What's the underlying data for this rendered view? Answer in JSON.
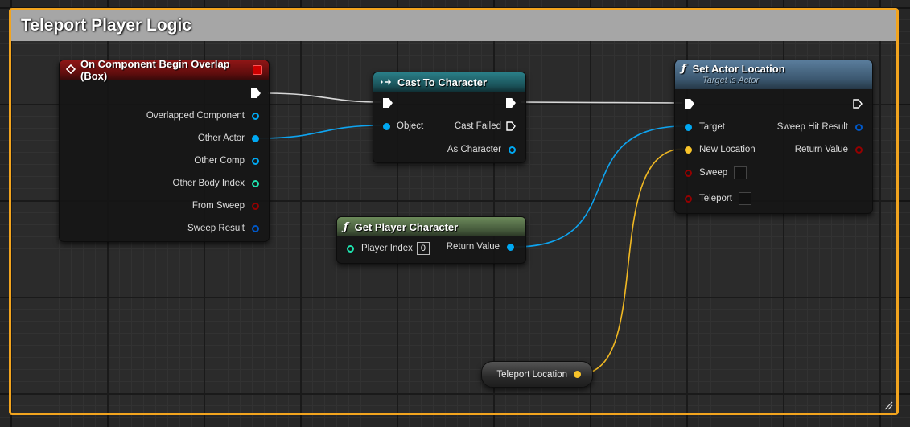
{
  "comment": {
    "title": "Teleport Player Logic",
    "color": "#f2a41e"
  },
  "colors": {
    "exec": "#ffffff",
    "object": "#00a8f2",
    "struct": "#0058c8",
    "integer": "#1fe3af",
    "boolean": "#950000",
    "vector": "#f8c42a"
  },
  "nodes": {
    "overlap": {
      "title": "On Component Begin Overlap (Box)",
      "icon": "event-diamond-icon",
      "pins": [
        "Overlapped Component",
        "Other Actor",
        "Other Comp",
        "Other Body Index",
        "From Sweep",
        "Sweep Result"
      ]
    },
    "cast": {
      "title": "Cast To Character",
      "icon": "cast-arrows-icon",
      "input": "Object",
      "outputs": [
        "Cast Failed",
        "As Character"
      ]
    },
    "get_player": {
      "title": "Get Player Character",
      "input": "Player Index",
      "input_value": "0",
      "output": "Return Value"
    },
    "set_location": {
      "title": "Set Actor Location",
      "subtitle": "Target is Actor",
      "inputs": [
        "Target",
        "New Location",
        "Sweep",
        "Teleport"
      ],
      "outputs": [
        "Sweep Hit Result",
        "Return Value"
      ]
    },
    "teleport_var": {
      "label": "Teleport Location"
    }
  }
}
